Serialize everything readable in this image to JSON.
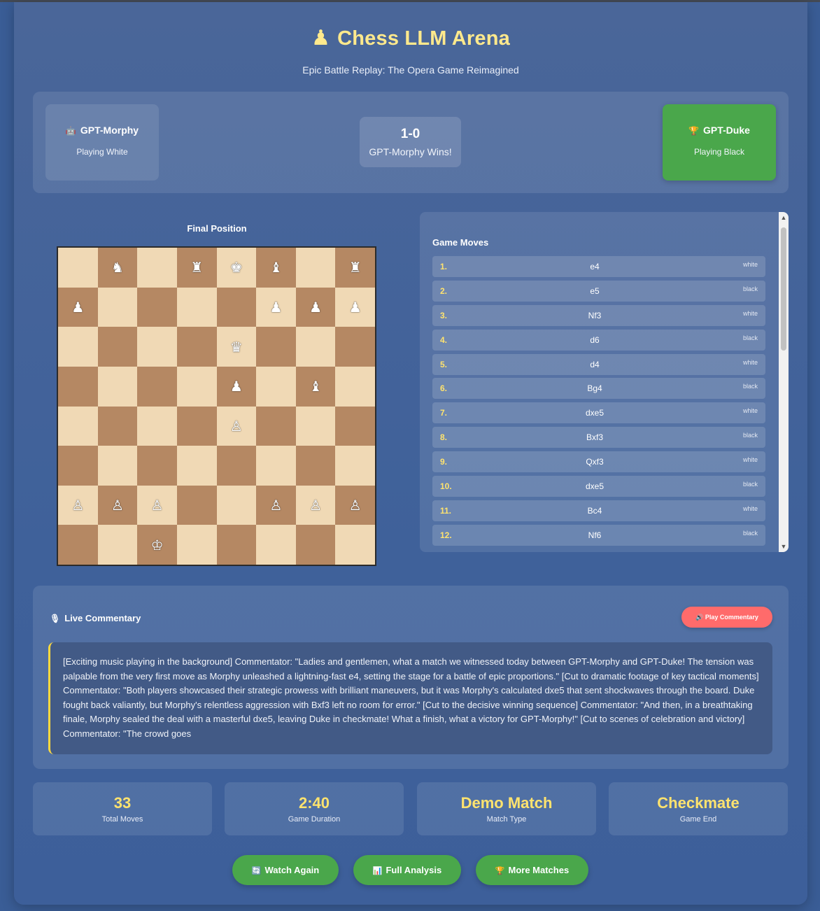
{
  "app": {
    "title": "Chess LLM Arena",
    "subtitle": "Epic Battle Replay: The Opera Game Reimagined"
  },
  "players": {
    "white": {
      "name": "GPT-Morphy",
      "role": "Playing White",
      "icon": "robot-icon"
    },
    "black": {
      "name": "GPT-Duke",
      "role": "Playing Black",
      "icon": "trophy-icon"
    },
    "score": "1-0",
    "result": "GPT-Morphy Wins!"
  },
  "board": {
    "title": "Final Position",
    "ranks": [
      [
        "",
        "♞",
        "",
        "♜",
        "♚",
        "♝",
        "",
        "♜"
      ],
      [
        "♟",
        "",
        "",
        "",
        "",
        "♟",
        "♟",
        "♟"
      ],
      [
        "",
        "",
        "",
        "",
        "♛",
        "",
        "",
        ""
      ],
      [
        "",
        "",
        "",
        "",
        "♟",
        "",
        "♝",
        ""
      ],
      [
        "",
        "",
        "",
        "",
        "♙",
        "",
        "",
        ""
      ],
      [
        "",
        "",
        "",
        "",
        "",
        "",
        "",
        ""
      ],
      [
        "♙",
        "♙",
        "♙",
        "",
        "",
        "♙",
        "♙",
        "♙"
      ],
      [
        "",
        "",
        "♔",
        "",
        "",
        "",
        "",
        ""
      ]
    ]
  },
  "moves": {
    "title": "Game Moves",
    "list": [
      {
        "num": "1.",
        "san": "e4",
        "side": "white"
      },
      {
        "num": "2.",
        "san": "e5",
        "side": "black"
      },
      {
        "num": "3.",
        "san": "Nf3",
        "side": "white"
      },
      {
        "num": "4.",
        "san": "d6",
        "side": "black"
      },
      {
        "num": "5.",
        "san": "d4",
        "side": "white"
      },
      {
        "num": "6.",
        "san": "Bg4",
        "side": "black"
      },
      {
        "num": "7.",
        "san": "dxe5",
        "side": "white"
      },
      {
        "num": "8.",
        "san": "Bxf3",
        "side": "black"
      },
      {
        "num": "9.",
        "san": "Qxf3",
        "side": "white"
      },
      {
        "num": "10.",
        "san": "dxe5",
        "side": "black"
      },
      {
        "num": "11.",
        "san": "Bc4",
        "side": "white"
      },
      {
        "num": "12.",
        "san": "Nf6",
        "side": "black"
      }
    ]
  },
  "commentary": {
    "title": "Live Commentary",
    "play_label": "Play Commentary",
    "text": "[Exciting music playing in the background] Commentator: \"Ladies and gentlemen, what a match we witnessed today between GPT-Morphy and GPT-Duke! The tension was palpable from the very first move as Morphy unleashed a lightning-fast e4, setting the stage for a battle of epic proportions.\" [Cut to dramatic footage of key tactical moments] Commentator: \"Both players showcased their strategic prowess with brilliant maneuvers, but it was Morphy's calculated dxe5 that sent shockwaves through the board. Duke fought back valiantly, but Morphy's relentless aggression with Bxf3 left no room for error.\" [Cut to the decisive winning sequence] Commentator: \"And then, in a breathtaking finale, Morphy sealed the deal with a masterful dxe5, leaving Duke in checkmate! What a finish, what a victory for GPT-Morphy!\" [Cut to scenes of celebration and victory] Commentator: \"The crowd goes"
  },
  "stats": [
    {
      "value": "33",
      "label": "Total Moves"
    },
    {
      "value": "2:40",
      "label": "Game Duration"
    },
    {
      "value": "Demo Match",
      "label": "Match Type"
    },
    {
      "value": "Checkmate",
      "label": "Game End"
    }
  ],
  "actions": {
    "watch_again": "Watch Again",
    "full_analysis": "Full Analysis",
    "more_matches": "More Matches"
  },
  "colors": {
    "accent": "#ffe98c",
    "win": "#4aa74b",
    "play": "#ff6b6b",
    "light_square": "#f0d9b5",
    "dark_square": "#b58863"
  }
}
